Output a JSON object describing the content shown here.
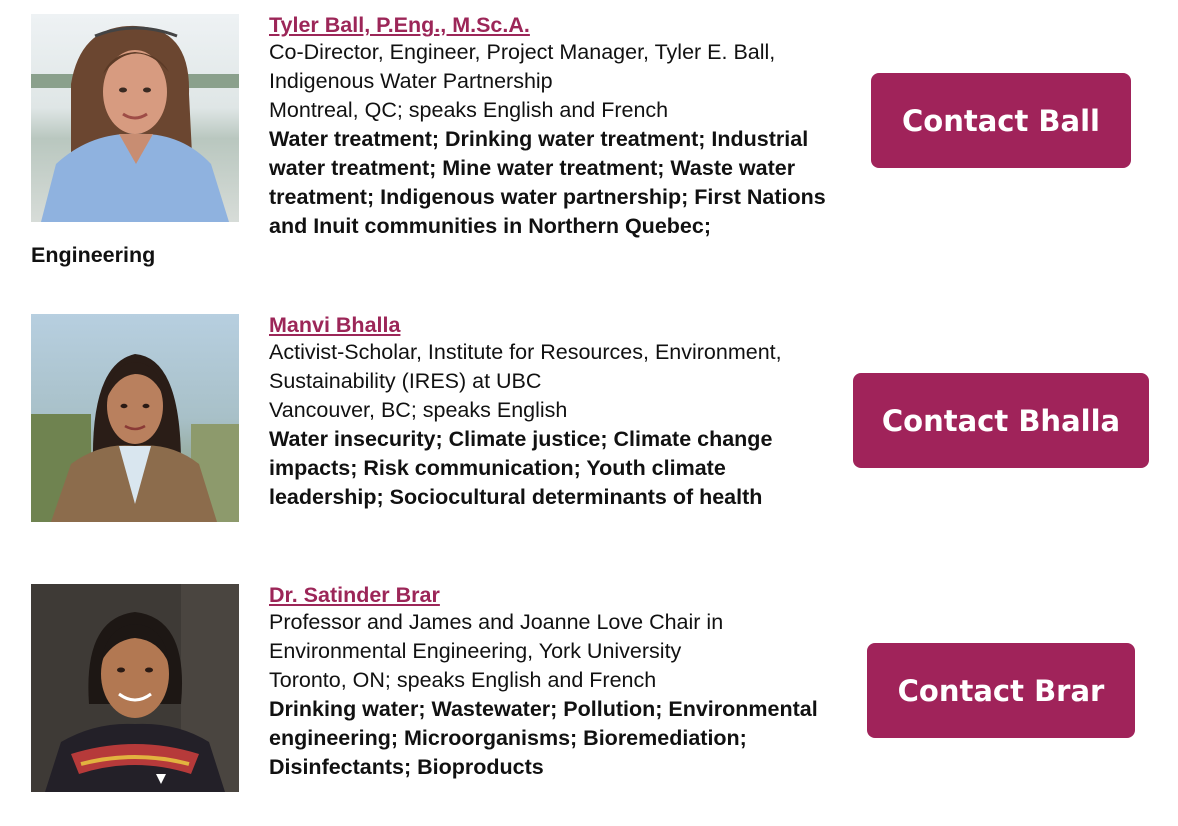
{
  "colors": {
    "accent": "#a0235a",
    "link": "#9c2658",
    "text": "#111111"
  },
  "experts": [
    {
      "name": "Tyler Ball, P.Eng., M.Sc.A.",
      "title": "Co-Director, Engineer, Project Manager, Tyler E. Ball, Indigenous Water Partnership",
      "location": "Montreal, QC; speaks English and French",
      "topics": "Water treatment; Drinking water treatment; Industrial water treatment; Mine water treatment; Waste water treatment; Indigenous water partnership; First Nations and Inuit communities in Northern Quebec; Engineering",
      "button": "Contact Ball"
    },
    {
      "name": "Manvi Bhalla",
      "title": "Activist-Scholar, Institute for Resources, Environment, Sustainability (IRES) at UBC",
      "location": "Vancouver, BC; speaks English",
      "topics": "Water insecurity; Climate justice; Climate change impacts; Risk communication; Youth climate leadership; Sociocultural determinants of health",
      "button": "Contact Bhalla"
    },
    {
      "name": "Dr. Satinder Brar",
      "title": "Professor and James and Joanne Love Chair in Environmental Engineering, York University",
      "location": "Toronto, ON; speaks English and French",
      "topics": "Drinking water; Wastewater; Pollution; Environmental engineering; Microorganisms; Bioremediation; Disinfectants; Bioproducts",
      "button": "Contact Brar"
    }
  ]
}
